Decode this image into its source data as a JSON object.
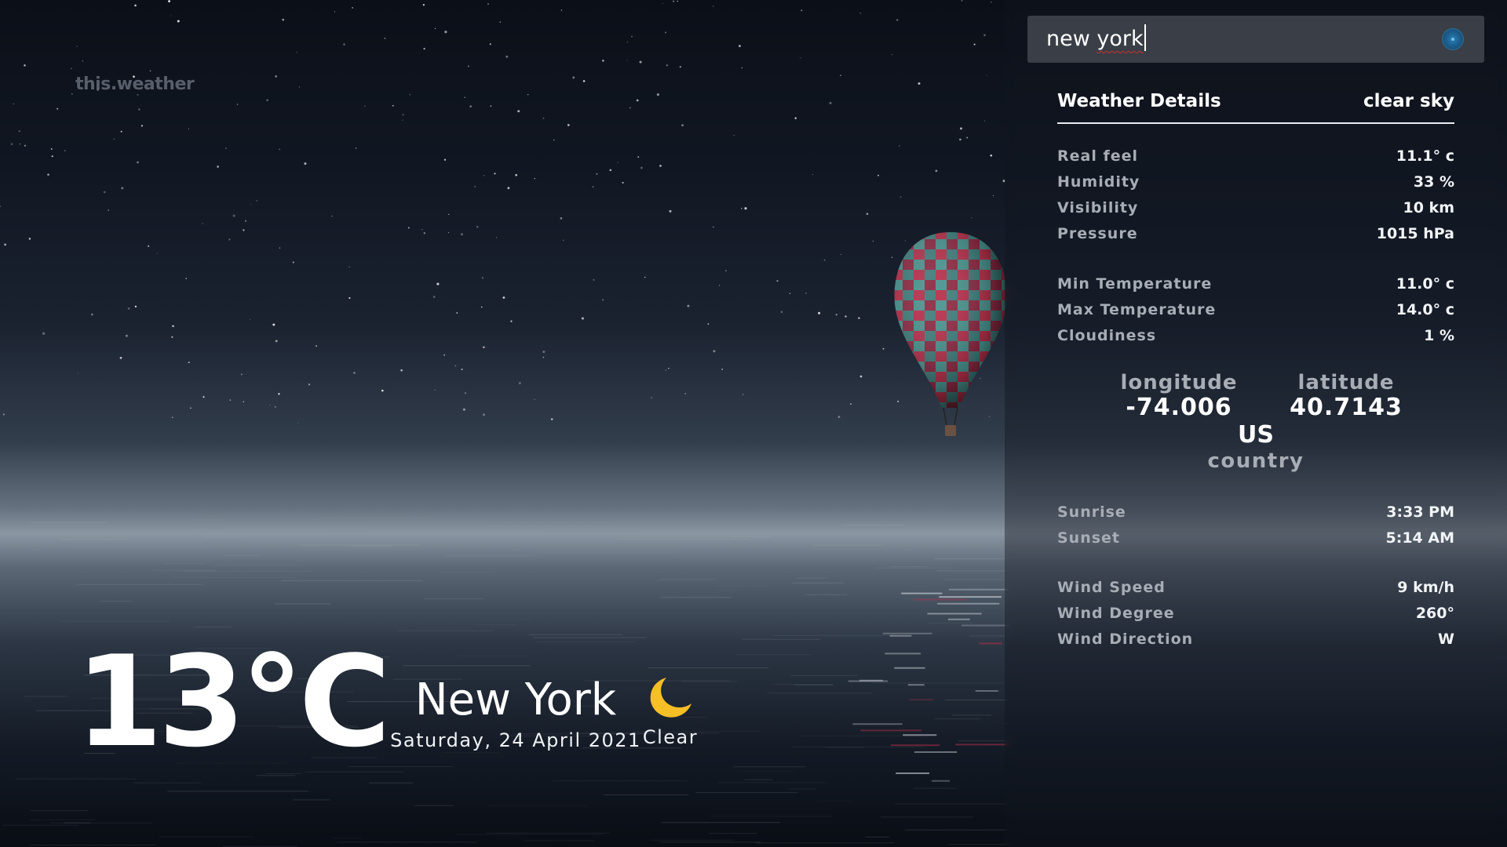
{
  "app": {
    "brand": "this.weather"
  },
  "current": {
    "temperature": "13°C",
    "city": "New York",
    "date": "Saturday, 24 April 2021",
    "condition": "Clear",
    "condition_icon": "crescent-moon-icon",
    "icon_color": "#f6bf26"
  },
  "search": {
    "value": "new york",
    "misspelled_word": "york",
    "button_icon": "search-icon",
    "button_color": "#1d5f8e"
  },
  "details": {
    "title": "Weather Details",
    "summary": "clear sky",
    "primary": [
      {
        "label": "Real feel",
        "value": "11.1° c"
      },
      {
        "label": "Humidity",
        "value": "33 %"
      },
      {
        "label": "Visibility",
        "value": "10 km"
      },
      {
        "label": "Pressure",
        "value": "1015 hPa"
      }
    ],
    "temperature": [
      {
        "label": "Min Temperature",
        "value": "11.0° c"
      },
      {
        "label": "Max Temperature",
        "value": "14.0° c"
      },
      {
        "label": "Cloudiness",
        "value": "1 %"
      }
    ],
    "geo": {
      "longitude_label": "longitude",
      "longitude_value": "-74.006",
      "latitude_label": "latitude",
      "latitude_value": "40.7143",
      "country_code": "US",
      "country_label": "country"
    },
    "sun": [
      {
        "label": "Sunrise",
        "value": "3:33 PM"
      },
      {
        "label": "Sunset",
        "value": "5:14 AM"
      }
    ],
    "wind": [
      {
        "label": "Wind Speed",
        "value": "9 km/h"
      },
      {
        "label": "Wind Degree",
        "value": "260°"
      },
      {
        "label": "Wind Direction",
        "value": "W"
      }
    ]
  }
}
